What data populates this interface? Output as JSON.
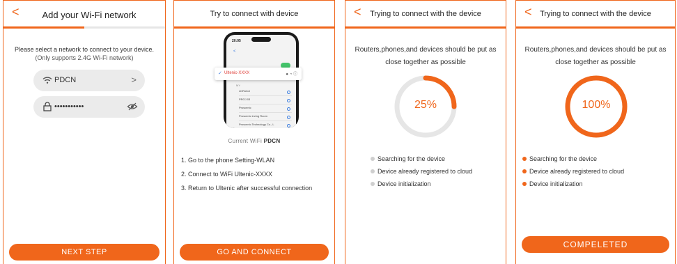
{
  "screen1": {
    "title": "Add your Wi-Fi network",
    "progress_percent": 50,
    "description": "Please select a network to connect to your device.",
    "description_sub": "(Only supports 2.4G Wi-Fi network)",
    "wifi_name": "PDCN",
    "password_value": "•••••••••••",
    "button": "NEXT STEP"
  },
  "screen2": {
    "title": "Try to connect with device",
    "phone": {
      "time": "20:05",
      "selected_network": "Ultenic-XXXX",
      "other_label": "MY",
      "networks": [
        "LDRobot",
        "PROJ.03",
        "Proscenic",
        "Proscenic Living Room",
        "Proscenic Technology Co., L"
      ]
    },
    "current_wifi_label": "Current WiFi ",
    "current_wifi_name": "PDCN",
    "steps": [
      "1. Go to the phone Setting-WLAN",
      "2. Connect to WiFi Ultenic-XXXX",
      "3. Return to Ultenic after successful connection"
    ],
    "button": "GO AND CONNECT"
  },
  "screen3": {
    "title": "Trying to connect with the device",
    "hint": "Routers,phones,and devices should be put as close together as possible",
    "progress_value": 25,
    "progress_text": "25%",
    "statuses": [
      {
        "label": "Searching for the device",
        "done": false
      },
      {
        "label": "Device already registered to cloud",
        "done": false
      },
      {
        "label": "Device initialization",
        "done": false
      }
    ]
  },
  "screen4": {
    "title": "Trying to connect with the device",
    "hint": "Routers,phones,and devices should be put as close together as possible",
    "progress_value": 100,
    "progress_text": "100%",
    "statuses": [
      {
        "label": "Searching for the device",
        "done": true
      },
      {
        "label": "Device already registered to cloud",
        "done": true
      },
      {
        "label": "Device initialization",
        "done": true
      }
    ],
    "button": "COMPELETED"
  },
  "colors": {
    "accent": "#f0661b",
    "track": "#e6e6e6",
    "dot_inactive": "#cfcfcf"
  },
  "icons": {
    "back": "<",
    "chevron": ">"
  }
}
